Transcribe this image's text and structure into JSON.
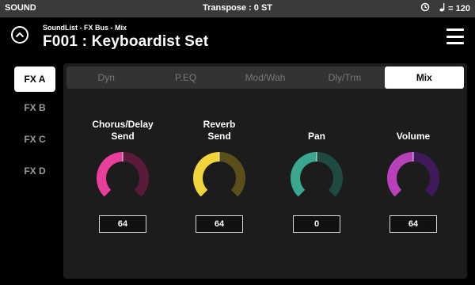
{
  "topbar": {
    "mode": "SOUND",
    "transpose": "Transpose : 0 ST",
    "tempo_value": "= 120",
    "tap_icon": "loop-arrow-icon",
    "note_icon": "quarter-note-icon"
  },
  "header": {
    "breadcrumb": "SoundList - FX Bus - Mix",
    "title": "F001 : Keyboardist Set"
  },
  "sidebar": {
    "items": [
      {
        "label": "FX A",
        "active": true
      },
      {
        "label": "FX B",
        "active": false
      },
      {
        "label": "FX C",
        "active": false
      },
      {
        "label": "FX D",
        "active": false
      }
    ]
  },
  "tabs": [
    {
      "label": "Dyn",
      "active": false
    },
    {
      "label": "P.EQ",
      "active": false
    },
    {
      "label": "Mod/Wah",
      "active": false
    },
    {
      "label": "Dly/Trm",
      "active": false
    },
    {
      "label": "Mix",
      "active": true
    }
  ],
  "knobs": [
    {
      "label_line1": "Chorus/Delay",
      "label_line2": "Send",
      "value": "64",
      "fraction": 0.5,
      "color": "#e8409a",
      "track_color": "#5a1a3a"
    },
    {
      "label_line1": "Reverb",
      "label_line2": "Send",
      "value": "64",
      "fraction": 0.5,
      "color": "#f0d43a",
      "track_color": "#5a4e1a"
    },
    {
      "label_line1": "",
      "label_line2": "Pan",
      "value": "0",
      "fraction": 0.5,
      "color": "#3aa890",
      "track_color": "#1e4a42"
    },
    {
      "label_line1": "",
      "label_line2": "Volume",
      "value": "64",
      "fraction": 0.5,
      "color": "#b840b8",
      "track_color": "#3e1a5a"
    }
  ]
}
